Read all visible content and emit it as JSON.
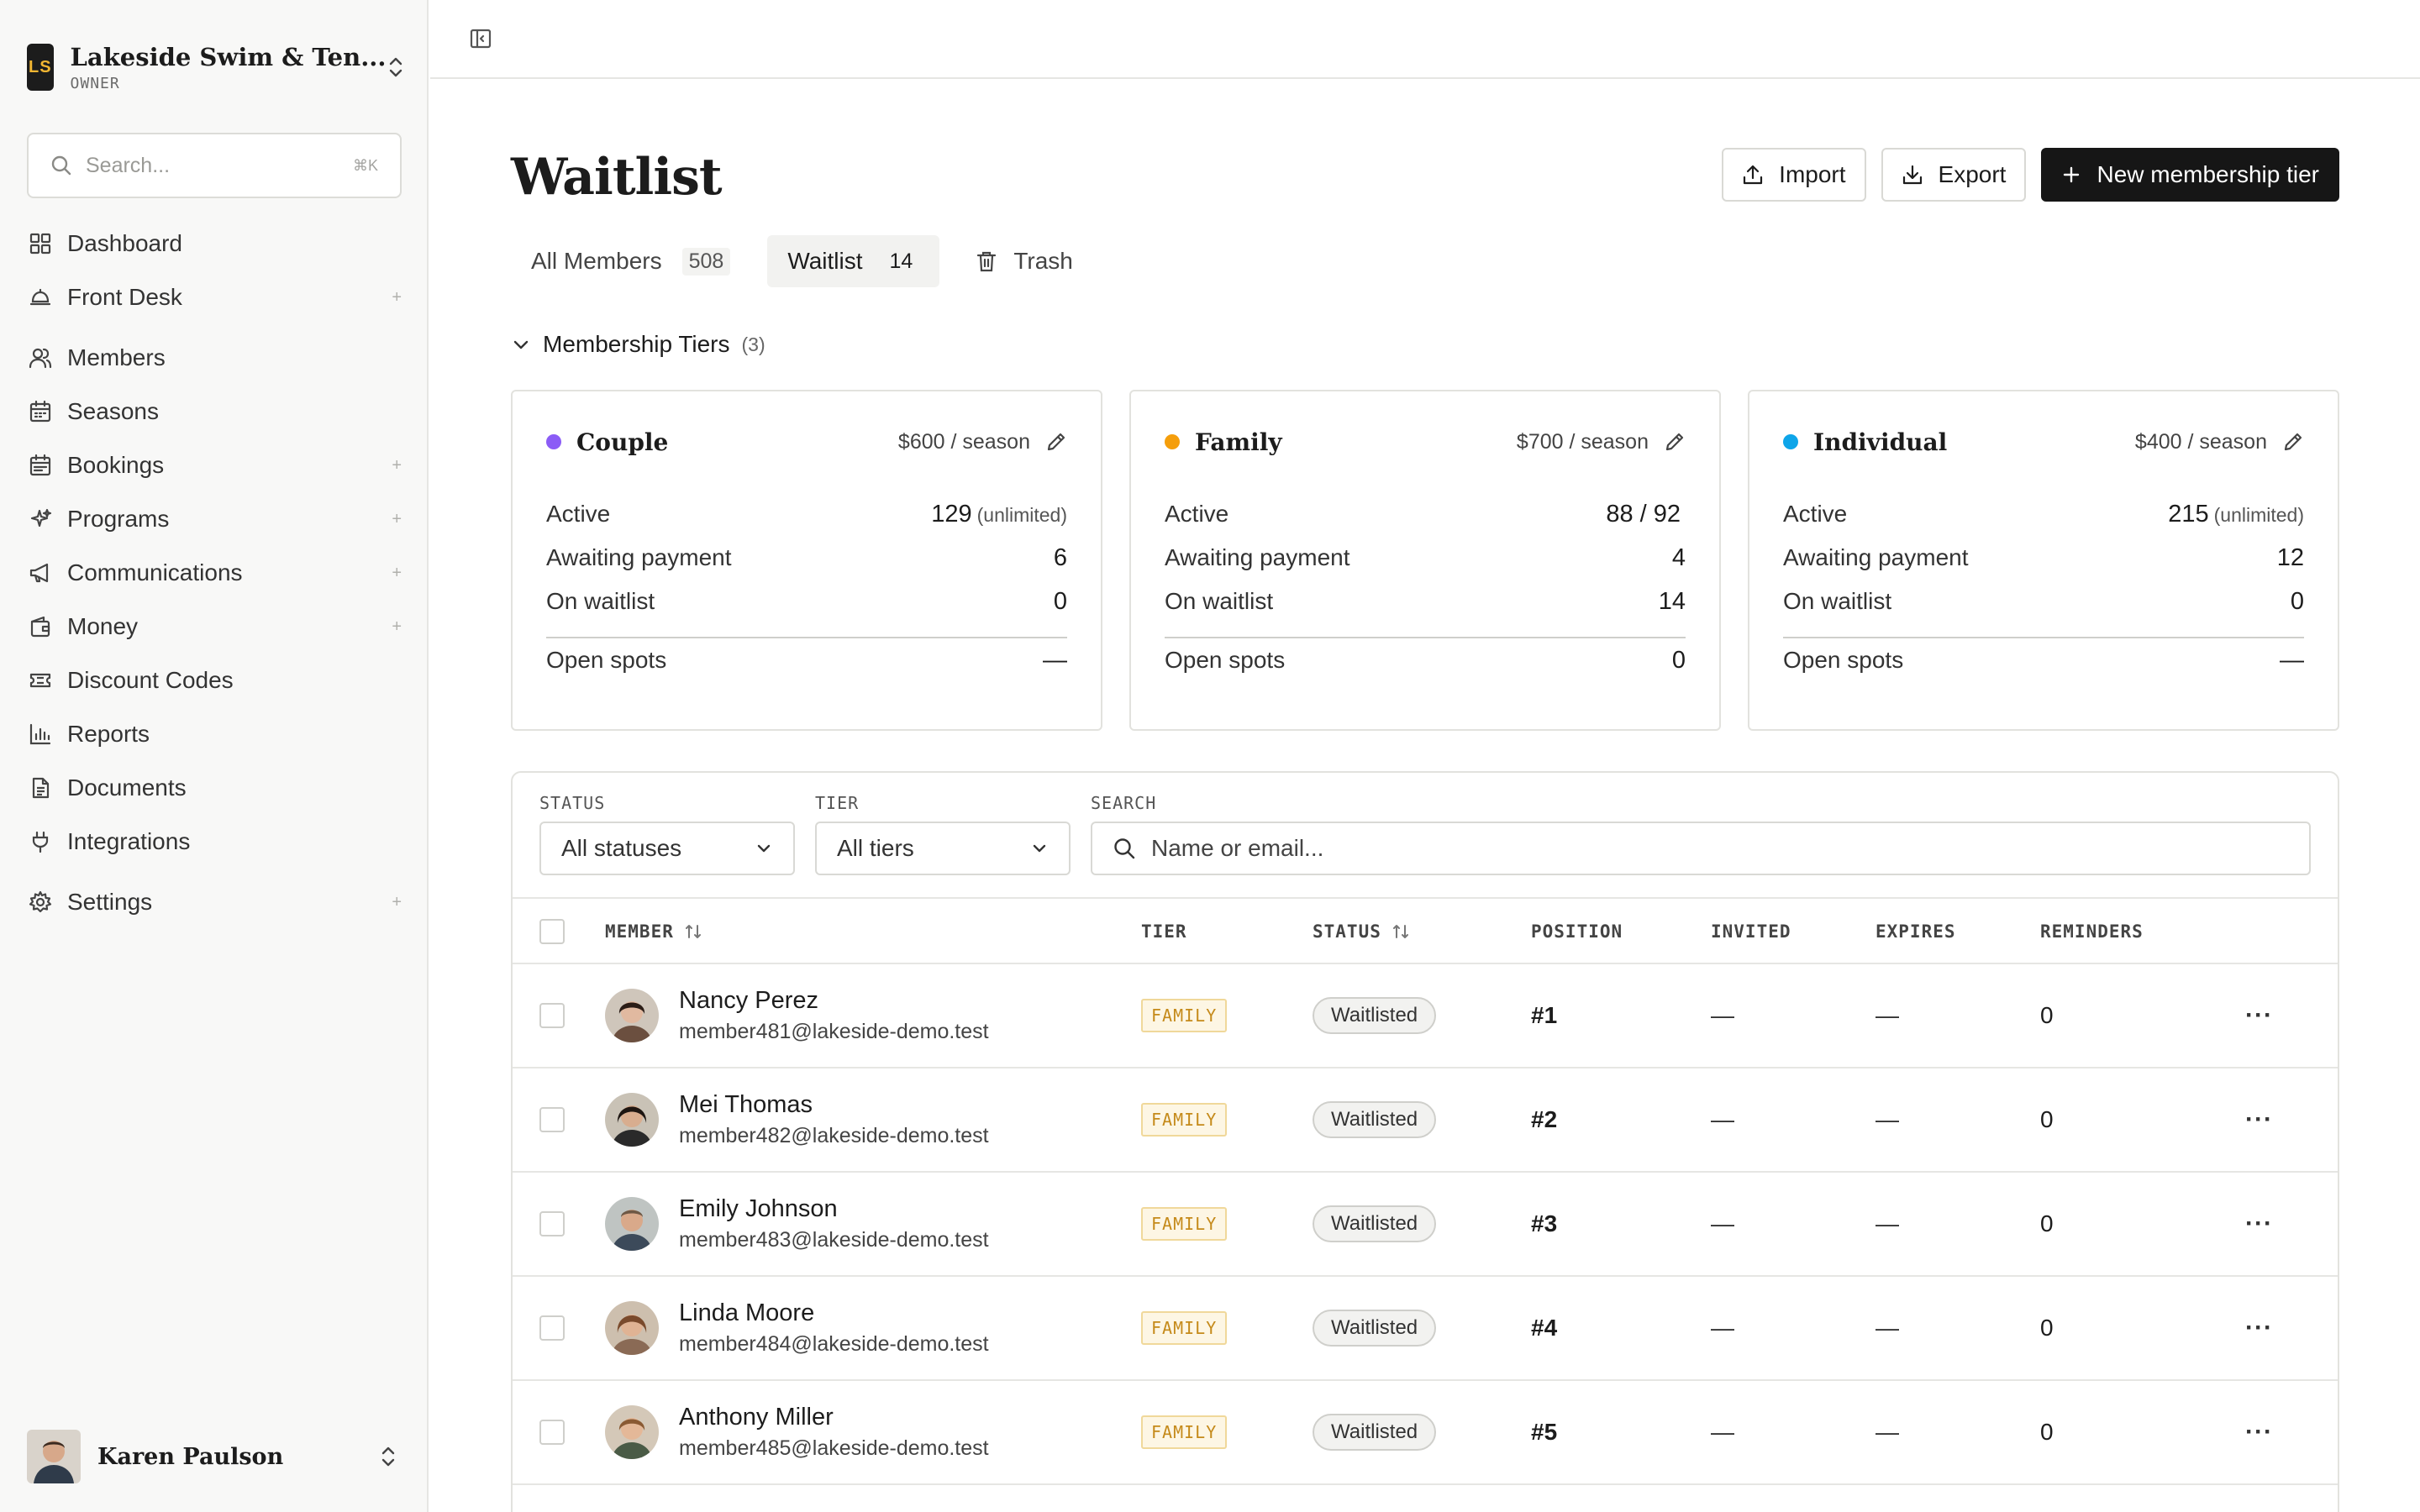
{
  "org": {
    "initials": "LS",
    "name": "Lakeside Swim & Ten...",
    "role": "OWNER"
  },
  "sidebar": {
    "search_placeholder": "Search...",
    "search_shortcut": "⌘K",
    "items": [
      {
        "label": "Dashboard",
        "icon": "grid-icon",
        "plus": ""
      },
      {
        "label": "Front Desk",
        "icon": "bell-desk-icon",
        "plus": "+"
      },
      {
        "label": "Members",
        "icon": "users-icon",
        "plus": ""
      },
      {
        "label": "Seasons",
        "icon": "calendar-icon",
        "plus": ""
      },
      {
        "label": "Bookings",
        "icon": "calendar-check-icon",
        "plus": "+"
      },
      {
        "label": "Programs",
        "icon": "sparkle-icon",
        "plus": "+"
      },
      {
        "label": "Communications",
        "icon": "megaphone-icon",
        "plus": "+"
      },
      {
        "label": "Money",
        "icon": "wallet-icon",
        "plus": "+"
      },
      {
        "label": "Discount Codes",
        "icon": "ticket-icon",
        "plus": ""
      },
      {
        "label": "Reports",
        "icon": "bar-chart-icon",
        "plus": ""
      },
      {
        "label": "Documents",
        "icon": "document-icon",
        "plus": ""
      },
      {
        "label": "Integrations",
        "icon": "plug-icon",
        "plus": ""
      },
      {
        "label": "Settings",
        "icon": "gear-icon",
        "plus": "+"
      }
    ]
  },
  "user": {
    "name": "Karen Paulson"
  },
  "page": {
    "title": "Waitlist"
  },
  "actions": {
    "import": "Import",
    "export": "Export",
    "new_tier": "New membership tier"
  },
  "tabs": [
    {
      "label": "All Members",
      "count": "508"
    },
    {
      "label": "Waitlist",
      "count": "14"
    },
    {
      "label": "Trash",
      "count": ""
    }
  ],
  "tiers_section": {
    "title": "Membership Tiers",
    "count": "(3)"
  },
  "tiers": [
    {
      "name": "Couple",
      "price": "$600 / season",
      "color": "#8b5cf6",
      "active": "129",
      "active_sub": "(unlimited)",
      "awaiting": "6",
      "waitlist": "0",
      "open": "—",
      "labels": {
        "active": "Active",
        "awaiting": "Awaiting payment",
        "waitlist": "On waitlist",
        "open": "Open spots"
      }
    },
    {
      "name": "Family",
      "price": "$700 / season",
      "color": "#f59e0b",
      "active": "88 / 92",
      "active_sub": "",
      "awaiting": "4",
      "waitlist": "14",
      "open": "0",
      "labels": {
        "active": "Active",
        "awaiting": "Awaiting payment",
        "waitlist": "On waitlist",
        "open": "Open spots"
      }
    },
    {
      "name": "Individual",
      "price": "$400 / season",
      "color": "#0ea5e9",
      "active": "215",
      "active_sub": "(unlimited)",
      "awaiting": "12",
      "waitlist": "0",
      "open": "—",
      "labels": {
        "active": "Active",
        "awaiting": "Awaiting payment",
        "waitlist": "On waitlist",
        "open": "Open spots"
      }
    }
  ],
  "filters": {
    "status_label": "STATUS",
    "status_value": "All statuses",
    "tier_label": "TIER",
    "tier_value": "All tiers",
    "search_label": "SEARCH",
    "search_placeholder": "Name or email..."
  },
  "table": {
    "columns": [
      "MEMBER",
      "TIER",
      "STATUS",
      "POSITION",
      "INVITED",
      "EXPIRES",
      "REMINDERS"
    ],
    "rows": [
      {
        "name": "Nancy Perez",
        "email": "member481@lakeside-demo.test",
        "tier": "FAMILY",
        "status": "Waitlisted",
        "position": "#1",
        "invited": "—",
        "expires": "—",
        "reminders": "0"
      },
      {
        "name": "Mei Thomas",
        "email": "member482@lakeside-demo.test",
        "tier": "FAMILY",
        "status": "Waitlisted",
        "position": "#2",
        "invited": "—",
        "expires": "—",
        "reminders": "0"
      },
      {
        "name": "Emily Johnson",
        "email": "member483@lakeside-demo.test",
        "tier": "FAMILY",
        "status": "Waitlisted",
        "position": "#3",
        "invited": "—",
        "expires": "—",
        "reminders": "0"
      },
      {
        "name": "Linda Moore",
        "email": "member484@lakeside-demo.test",
        "tier": "FAMILY",
        "status": "Waitlisted",
        "position": "#4",
        "invited": "—",
        "expires": "—",
        "reminders": "0"
      },
      {
        "name": "Anthony Miller",
        "email": "member485@lakeside-demo.test",
        "tier": "FAMILY",
        "status": "Waitlisted",
        "position": "#5",
        "invited": "—",
        "expires": "—",
        "reminders": "0"
      }
    ],
    "more_label": "···"
  }
}
